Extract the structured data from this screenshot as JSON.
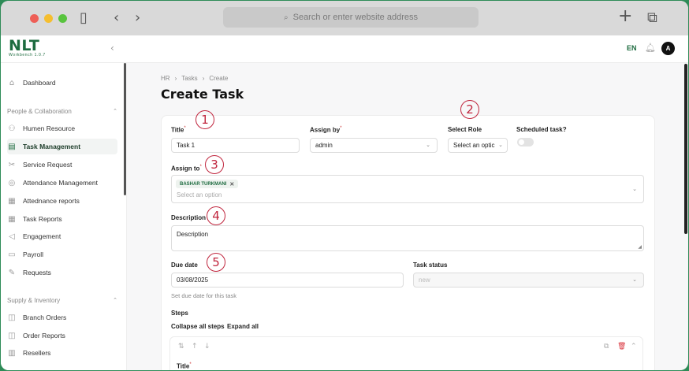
{
  "browser": {
    "url_placeholder": "Search or enter website address"
  },
  "header": {
    "logo": "NLT",
    "logo_sub": "Workbench 1.0.7",
    "language": "EN",
    "avatar_letter": "A"
  },
  "sidebar": {
    "dashboard": "Dashboard",
    "group1": "People & Collaboration",
    "items1": [
      "Humen Resource",
      "Task Management",
      "Service Request",
      "Attendance Management",
      "Attednance reports",
      "Task Reports",
      "Engagement",
      "Payroll",
      "Requests"
    ],
    "group2": "Supply & Inventory",
    "items2": [
      "Branch Orders",
      "Order Reports",
      "Resellers"
    ]
  },
  "breadcrumb": {
    "hr": "HR",
    "tasks": "Tasks",
    "create": "Create"
  },
  "page_title": "Create Task",
  "form": {
    "title_label": "Title",
    "title_value": "Task 1",
    "assign_by_label": "Assign by",
    "assign_by_value": "admin",
    "select_role_label": "Select Role",
    "select_role_placeholder": "Select an optic",
    "scheduled_label": "Scheduled task?",
    "assign_to_label": "Assign to",
    "assign_to_tag": "BASHAR TURKMANI",
    "assign_to_placeholder": "Select an option",
    "description_label": "Description",
    "description_value": "Description",
    "due_date_label": "Due date",
    "due_date_value": "03/08/2025",
    "due_date_help": "Set due date for this task",
    "task_status_label": "Task status",
    "task_status_value": "new",
    "steps_label": "Steps",
    "collapse_all": "Collapse all steps",
    "expand_all": "Expand all",
    "step_title_label": "Title"
  },
  "annotations": [
    "1",
    "2",
    "3",
    "4",
    "5"
  ]
}
